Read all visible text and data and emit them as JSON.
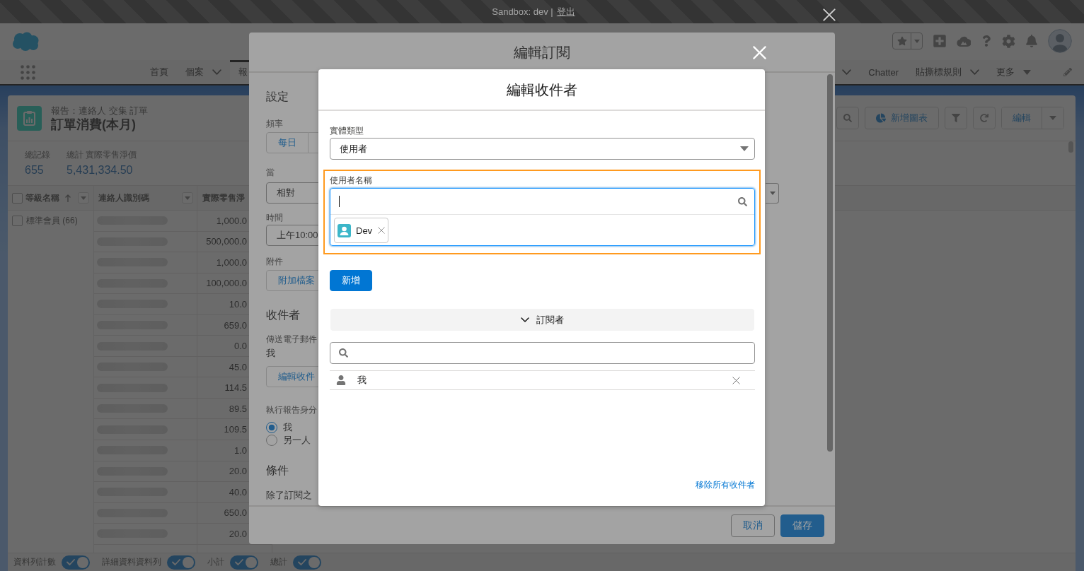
{
  "top_bar": {
    "label": "Sandbox: dev |",
    "link": "登出"
  },
  "nav": {
    "left_tabs": [
      {
        "label": "首頁",
        "selected": false,
        "kind": "plain"
      },
      {
        "label": "個案",
        "selected": false,
        "kind": "dropdown"
      },
      {
        "label": "報",
        "selected": true,
        "kind": "plain"
      }
    ],
    "right_tabs": [
      {
        "selected": false,
        "kind": "dropdown"
      },
      {
        "label": "Chatter",
        "selected": false,
        "kind": "plain"
      },
      {
        "label": "貼撕標規則",
        "selected": false,
        "kind": "dropdown"
      },
      {
        "label": "更多",
        "selected": false,
        "kind": "overflow"
      }
    ]
  },
  "report": {
    "breadcrumb": "報告：連絡人 交集 訂單",
    "title": "訂單消費(本月)",
    "toolbar": [
      {
        "kind": "search"
      },
      {
        "kind": "add_chart",
        "label": "新增圖表"
      },
      {
        "kind": "filter"
      },
      {
        "kind": "refresh"
      },
      {
        "kind": "edit",
        "label": "編輯"
      }
    ],
    "summary": [
      {
        "label": "總記錄",
        "value": "655"
      },
      {
        "label": "總計 實際零售淨價",
        "value": "5,431,334.50"
      }
    ],
    "table": {
      "header_checkbox": {
        "checked": false
      },
      "columns": [
        {
          "label": "等級名稱",
          "sort_ascending": true,
          "menu": true
        },
        {
          "label": "連絡人識別碼",
          "menu": true
        },
        {
          "label": "實際零售淨"
        }
      ],
      "group": {
        "label": "標準會員 (66)",
        "checked": false
      },
      "rows": [
        {
          "amount": "1,000.0"
        },
        {
          "amount": "500,000.0"
        },
        {
          "amount": "1,000.0"
        },
        {
          "amount": "100,000.0"
        },
        {
          "amount": "10.0"
        },
        {
          "amount": "659.0"
        },
        {
          "amount": "0.0"
        },
        {
          "amount": "45.0"
        },
        {
          "amount": "114.5"
        },
        {
          "amount": "89.5"
        },
        {
          "amount": "109.5"
        },
        {
          "amount": "1.0"
        },
        {
          "amount": "20.0"
        },
        {
          "amount": "40.0"
        },
        {
          "amount": "650.0"
        },
        {
          "amount": "20.0"
        }
      ]
    },
    "toggles": [
      {
        "label": "資料列計數",
        "on": true
      },
      {
        "label": "詳細資料資料列",
        "on": true
      },
      {
        "label": "小計",
        "on": true
      },
      {
        "label": "總計",
        "on": true
      }
    ]
  },
  "subscription_modal": {
    "title": "編輯訂閱",
    "settings_heading": "設定",
    "frequency": {
      "label": "頻率",
      "options": [
        "每日"
      ]
    },
    "when": {
      "label": "當",
      "value": "相對"
    },
    "time": {
      "label": "時間",
      "value": "上午10:00"
    },
    "attachment": {
      "label": "附件",
      "button": "附加檔案"
    },
    "recipients_heading": "收件者",
    "send_to": {
      "label": "傳送電子郵件",
      "value": "我",
      "button": "編輯收件"
    },
    "run_as": {
      "label": "執行報告身分",
      "options": [
        {
          "label": "我",
          "selected": true
        },
        {
          "label": "另一人",
          "selected": false
        }
      ]
    },
    "conditions_heading": "條件",
    "conditions_text": "除了訂閱之",
    "buttons": [
      {
        "label": "取消",
        "kind": "neutral"
      },
      {
        "label": "儲存",
        "kind": "brand"
      }
    ]
  },
  "recipients_modal": {
    "title": "編輯收件者",
    "entity_type": {
      "label": "實體類型",
      "value": "使用者"
    },
    "user_lookup": {
      "label": "使用者名稱",
      "highlighted": true,
      "focused": true,
      "selections": [
        {
          "label": "Dev"
        }
      ]
    },
    "add_button": "新增",
    "section": {
      "label": "訂閱者",
      "expanded": true
    },
    "recipients": [
      {
        "label": "我"
      }
    ],
    "remove_all": "移除所有收件者"
  }
}
